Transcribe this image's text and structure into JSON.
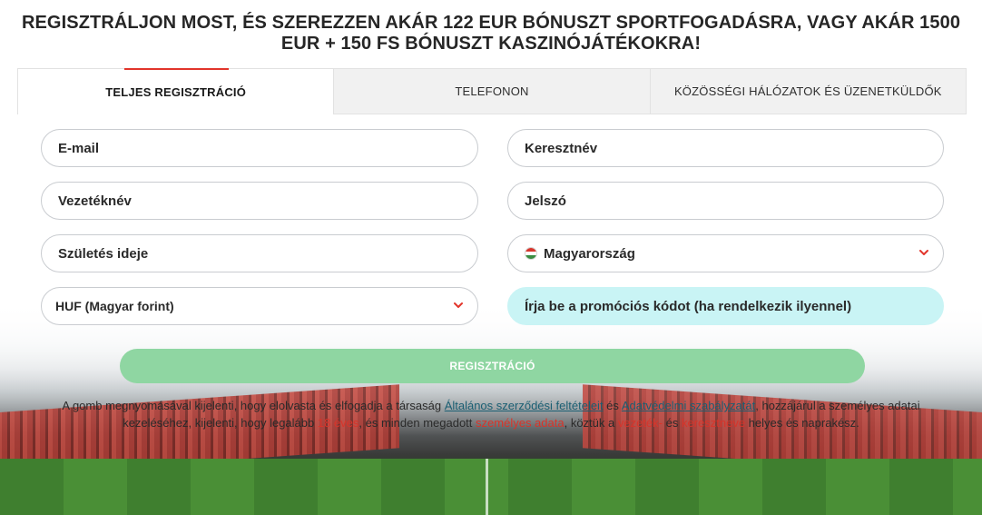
{
  "headline": "REGISZTRÁLJON MOST, ÉS SZEREZZEN AKÁR 122 EUR BÓNUSZT SPORTFOGADÁSRA, VAGY AKÁR 1500 EUR + 150 FS BÓNUSZT KASZINÓJÁTÉKOKRA!",
  "tabs": [
    {
      "label": "TELJES REGISZTRÁCIÓ",
      "active": true
    },
    {
      "label": "TELEFONON",
      "active": false
    },
    {
      "label": "KÖZÖSSÉGI HÁLÓZATOK ÉS ÜZENETKÜLDŐK",
      "active": false
    }
  ],
  "form": {
    "email": "E-mail",
    "first_name": "Keresztnév",
    "last_name": "Vezetéknév",
    "password": "Jelszó",
    "birth_date": "Születés ideje",
    "country": "Magyarország",
    "currency": "HUF (Magyar forint)",
    "promo": "Írja be a promóciós kódot (ha rendelkezik ilyennel)"
  },
  "register_button": "REGISZTRÁCIÓ",
  "legal": {
    "p1": "A gomb megnyomásával kijelenti, hogy elolvasta és elfogadja a társaság ",
    "terms_link": "Általános szerződési feltételeit",
    "p2": " és ",
    "privacy_link": "Adatvédelmi szabályzatát",
    "p3": ", hozzájárul a személyes adatai kezeléséhez, kijelenti, hogy legalább ",
    "age": "18 éves",
    "p4": ", és minden megadott ",
    "personal_data": "személyes adata",
    "p5": ", köztük a ",
    "surname": "vezeték-",
    "p6": " és ",
    "firstname": "keresztneve",
    "p7": " helyes és naprakész."
  },
  "colors": {
    "accent_red": "#e2352b",
    "button_green": "#8fd6a2",
    "promo_bg": "#c9f4f5",
    "link": "#1a5f73"
  },
  "icons": {
    "chevron": "chevron-down-icon",
    "flag": "hungary-flag-icon"
  }
}
